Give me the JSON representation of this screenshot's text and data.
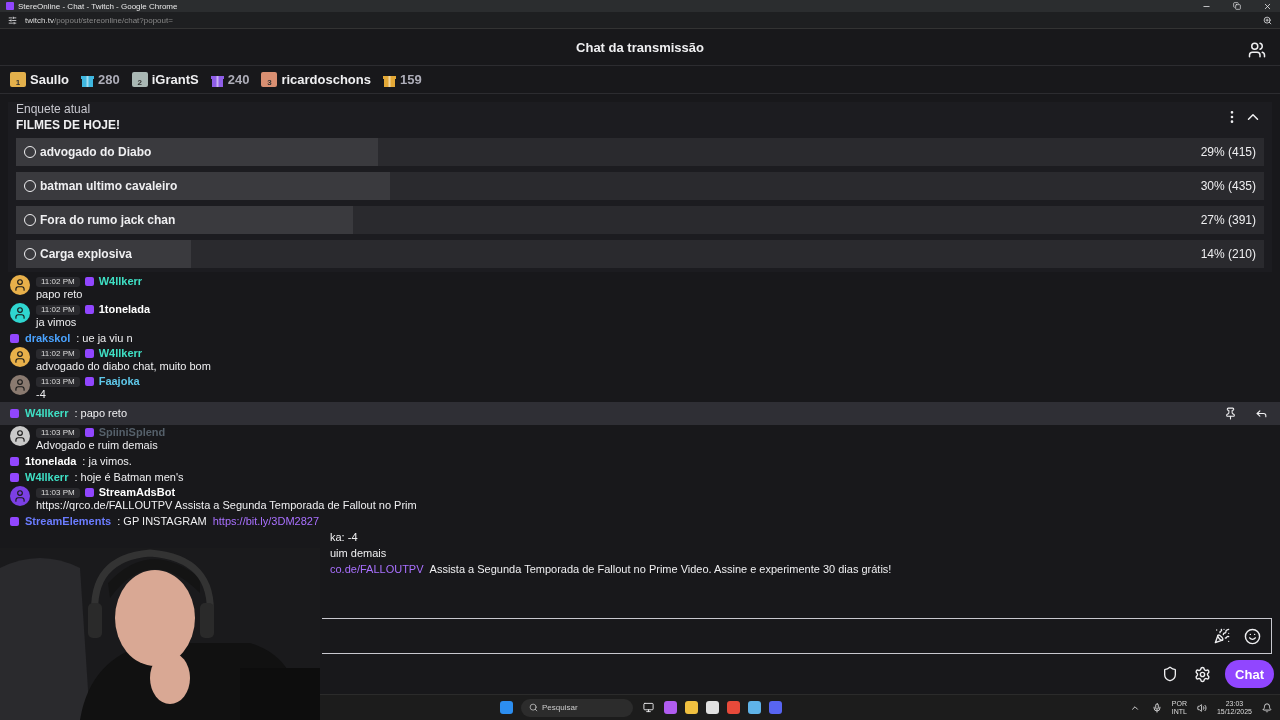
{
  "window": {
    "title": "StereOnline - Chat - Twitch - Google Chrome"
  },
  "address_bar": {
    "host": "twitch.tv",
    "path": "/popout/stereonline/chat?popout="
  },
  "header": {
    "title": "Chat da transmissão"
  },
  "leaderboard": [
    {
      "rank": "1",
      "name": "Saullo",
      "count": "280",
      "color": "#e3b04b",
      "gift": {
        "color": "#3fb7e0"
      }
    },
    {
      "rank": "2",
      "name": "iGrantS",
      "count": "240",
      "color": "#a9b7b4",
      "gift": {
        "color": "#8f5ee8"
      }
    },
    {
      "rank": "3",
      "name": "ricardoschons",
      "count": "159",
      "color": "#d98f72",
      "gift": {
        "color": "#e3a836"
      }
    }
  ],
  "poll": {
    "label": "Enquete atual",
    "title": "FILMES DE HOJE!",
    "options": [
      {
        "text": "advogado do Diabo",
        "result": "29% (415)",
        "level": 0.29
      },
      {
        "text": "batman ultimo cavaleiro",
        "result": "30% (435)",
        "level": 0.3
      },
      {
        "text": "Fora do rumo jack chan",
        "result": "27% (391)",
        "level": 0.27
      },
      {
        "text": "Carga explosiva",
        "result": "14% (210)",
        "level": 0.14
      }
    ]
  },
  "chat": [
    {
      "kind": "avatar",
      "time": "11:02 PM",
      "name": "W4llkerr",
      "color": "#3fe0c5",
      "avatar": {
        "color": "#e8b04a"
      },
      "text": "papo reto",
      "highlighted": false
    },
    {
      "kind": "avatar",
      "time": "11:02 PM",
      "name": "1tonelada",
      "color": "#ffffff",
      "avatar": {
        "color": "#2fd6d0"
      },
      "text": "ja vimos",
      "highlighted": false
    },
    {
      "kind": "inline",
      "name": "drakskol",
      "color": "#4aa3ff",
      "text": ": ue ja viu n",
      "highlighted": false
    },
    {
      "kind": "avatar",
      "time": "11:02 PM",
      "name": "W4llkerr",
      "color": "#3fe0c5",
      "avatar": {
        "color": "#e8b04a"
      },
      "text": "advogado do diabo chat, muito bom",
      "highlighted": false
    },
    {
      "kind": "avatar",
      "time": "11:03 PM",
      "name": "Faajoka",
      "color": "#5fc8ea",
      "avatar": {
        "color": "#8a7a70"
      },
      "text": "-4",
      "highlighted": false
    },
    {
      "kind": "inline",
      "name": "W4llkerr",
      "color": "#3fe0c5",
      "text": ": papo reto",
      "highlighted": true
    },
    {
      "kind": "avatar",
      "time": "11:03 PM",
      "name": "SpiiniSplend",
      "color": "#55606a",
      "avatar": {
        "color": "#c9c9c9"
      },
      "text": "Advogado e ruim demais",
      "highlighted": false
    },
    {
      "kind": "inline",
      "name": "1tonelada",
      "color": "#ffffff",
      "text": ": ja vimos.",
      "highlighted": false
    },
    {
      "kind": "inline",
      "name": "W4llkerr",
      "color": "#3fe0c5",
      "text": ": hoje é Batman men's",
      "highlighted": false
    },
    {
      "kind": "avatar",
      "time": "11:03 PM",
      "name": "StreamAdsBot",
      "color": "#ffffff",
      "avatar": {
        "color": "#7b3fe4"
      },
      "text": "https://qrco.de/FALLOUTPV Assista a Segunda Temporada de Fallout no Prim",
      "highlighted": false
    },
    {
      "kind": "inline",
      "name": "StreamElements",
      "color": "#6b7cff",
      "text": ": GP INSTAGRAM",
      "link": "https://bit.ly/3DM2827",
      "highlighted": false
    },
    {
      "kind": "partial",
      "text": "ka: -4",
      "highlighted": false
    },
    {
      "kind": "partial",
      "text": "uim demais",
      "highlighted": false
    },
    {
      "kind": "partial",
      "link": "co.de/FALLOUTPV",
      "text": " Assista a Segunda Temporada de Fallout no Prime Video. Assine e experimente 30 dias grátis!",
      "highlighted": false
    }
  ],
  "chat_button": "Chat",
  "taskbar": {
    "search_placeholder": "Pesquisar",
    "language": "POR",
    "layout": "INTL",
    "time": "23:03",
    "date": "15/12/2025"
  }
}
